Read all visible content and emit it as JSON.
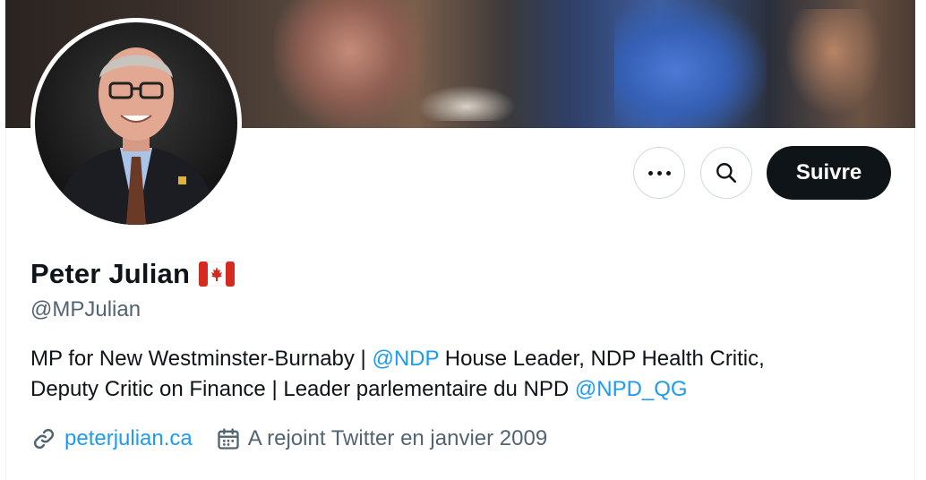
{
  "profile": {
    "name": "Peter Julian",
    "handle": "@MPJulian",
    "bio_line1_a": "MP for New Westminster-Burnaby | ",
    "bio_mention1": "@NDP",
    "bio_line1_b": " House Leader, NDP Health Critic,",
    "bio_line2_a": "Deputy Critic on Finance | Leader parlementaire du NPD ",
    "bio_mention2": "@NPD_QG",
    "website": "peterjulian.ca",
    "joined": "A rejoint Twitter en janvier 2009"
  },
  "actions": {
    "follow_label": "Suivre",
    "more_icon": "more-icon",
    "search_icon": "search-icon"
  },
  "colors": {
    "link": "#1d9bf0",
    "muted": "#536471",
    "text": "#0f1419"
  }
}
